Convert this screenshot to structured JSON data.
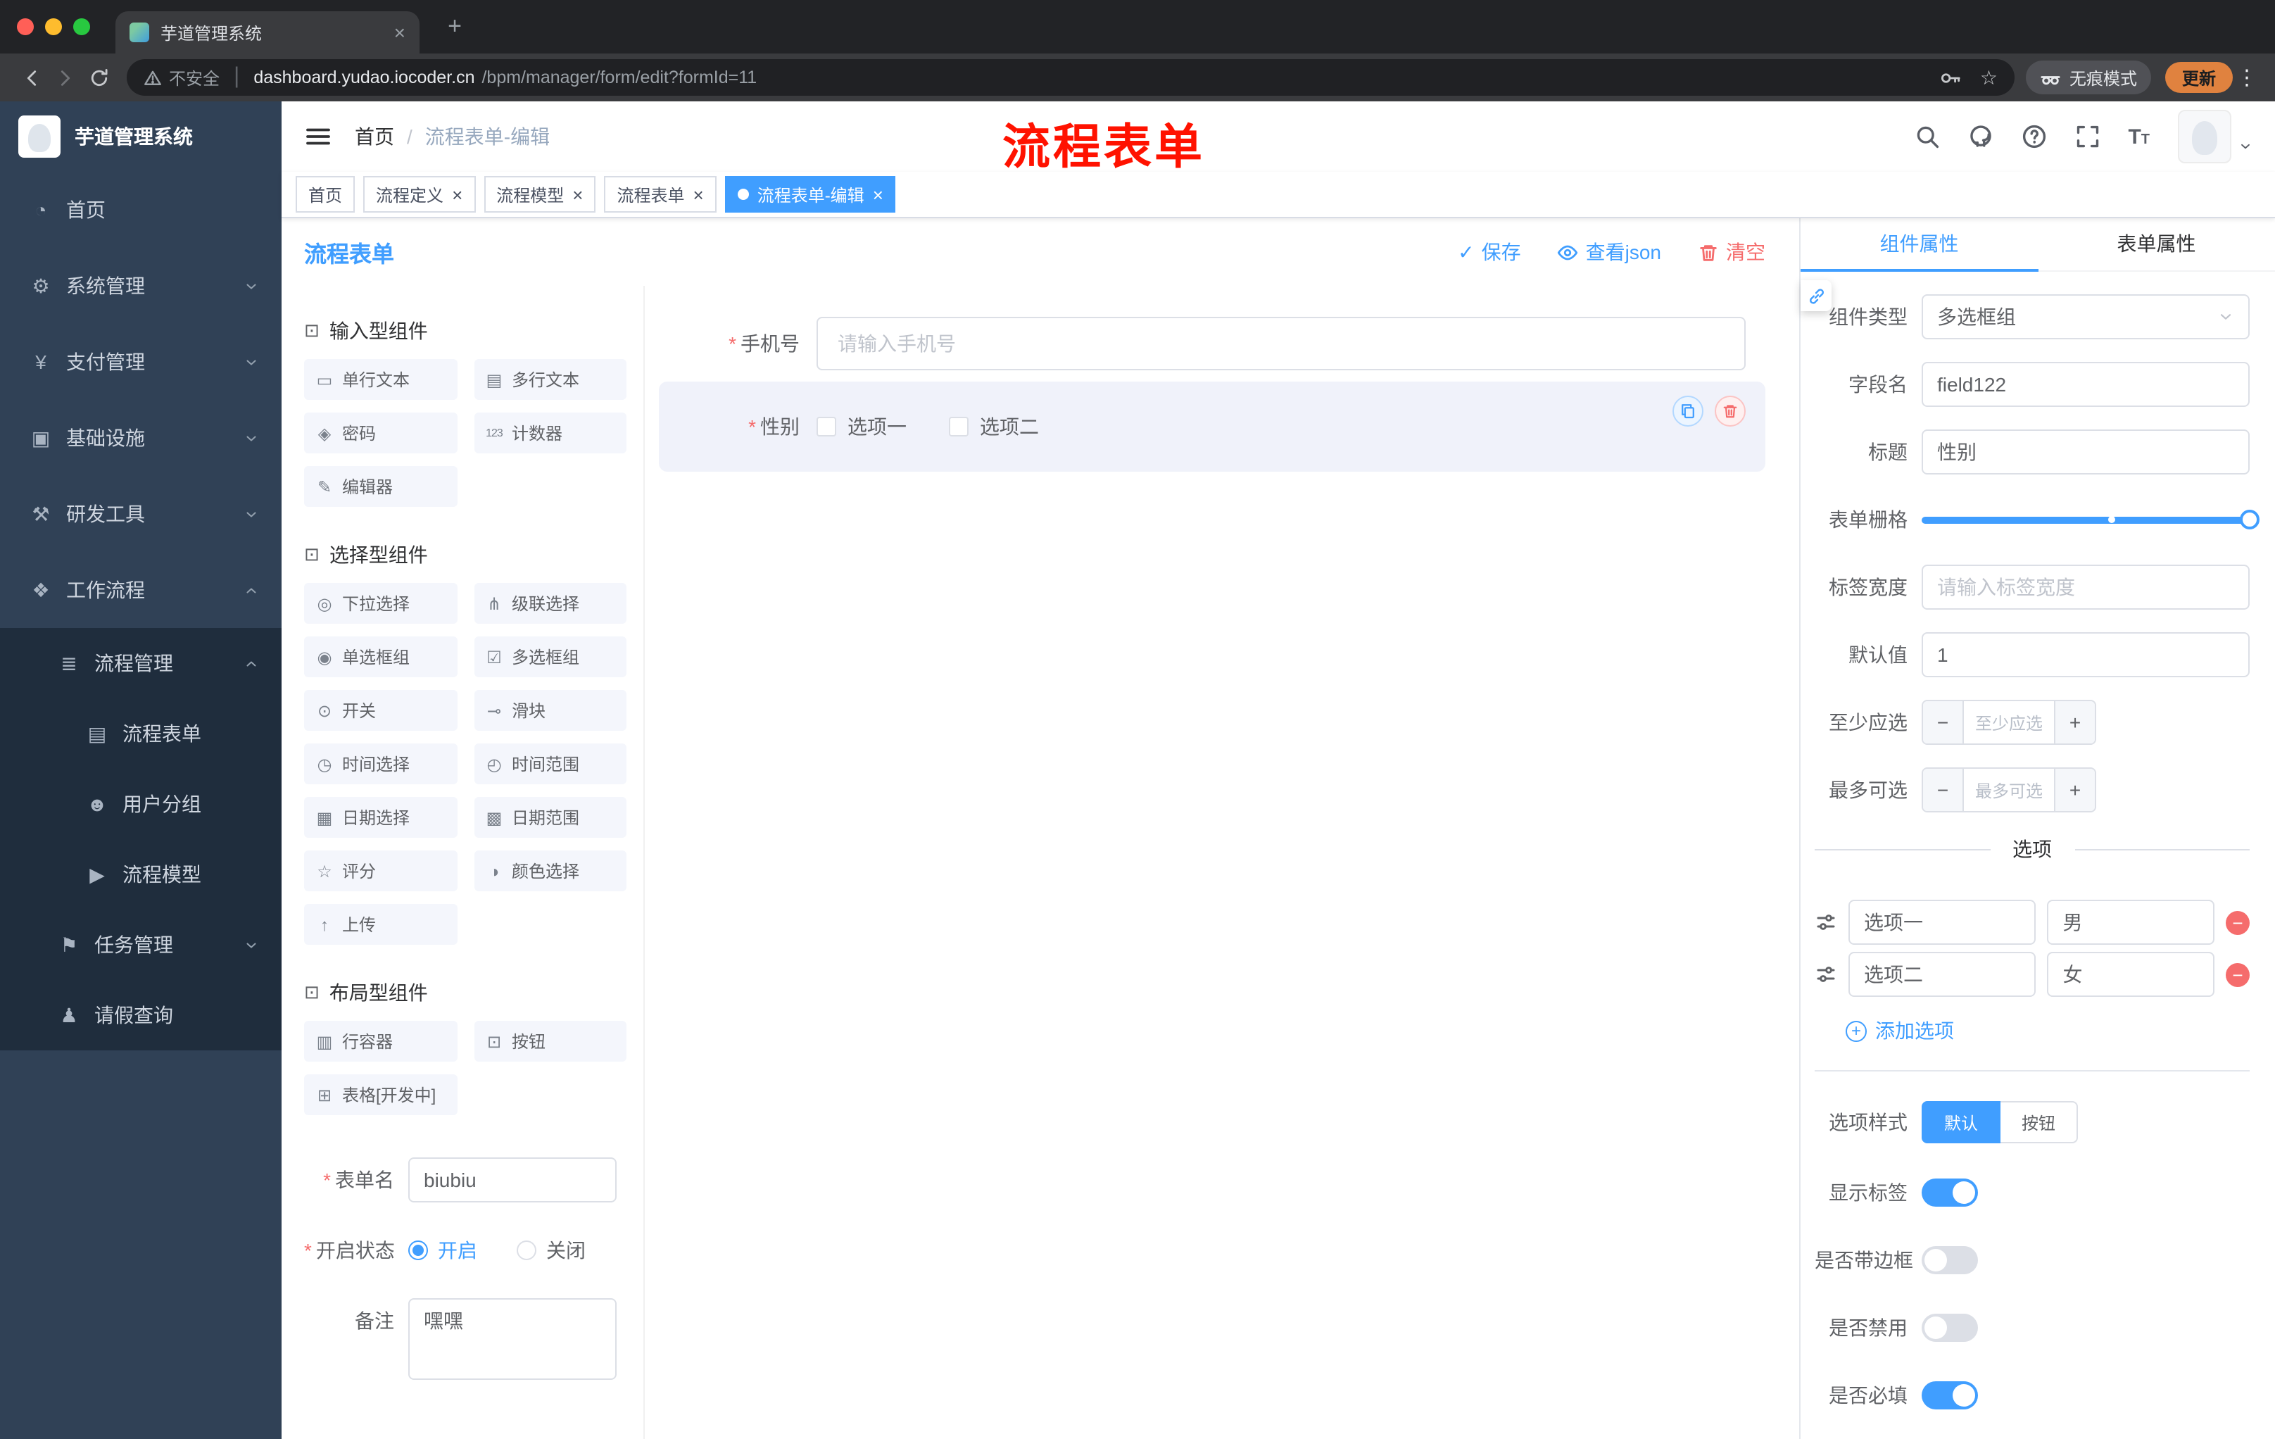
{
  "colors": {
    "accent": "#409eff",
    "danger": "#f56c6c",
    "sidebar_bg": "#304156",
    "submenu_bg": "#1f2d3d",
    "annotation_red": "#ff1200",
    "active_tag": "#409eff"
  },
  "browser": {
    "tab_title": "芋道管理系统",
    "security_label": "不安全",
    "url_domain": "dashboard.yudao.iocoder.cn",
    "url_path": "/bpm/manager/form/edit?formId=11",
    "incognito_label": "无痕模式",
    "update_label": "更新",
    "icons": [
      "back-icon",
      "forward-icon",
      "reload-icon",
      "warning-icon",
      "key-icon",
      "star-icon",
      "incognito-icon",
      "kebab-menu-icon"
    ]
  },
  "sidebar": {
    "logo_title": "芋道管理系统",
    "menu": [
      {
        "key": "home",
        "label": "首页",
        "icon": "gauge-icon",
        "level": 1
      },
      {
        "key": "system-mgmt",
        "label": "系统管理",
        "icon": "gear-icon",
        "level": 1,
        "chevron": "down"
      },
      {
        "key": "payment-mgmt",
        "label": "支付管理",
        "icon": "yen-icon",
        "level": 1,
        "chevron": "down"
      },
      {
        "key": "infrastructure",
        "label": "基础设施",
        "icon": "monitor-icon",
        "level": 1,
        "chevron": "down"
      },
      {
        "key": "dev-tools",
        "label": "研发工具",
        "icon": "tools-icon",
        "level": 1,
        "chevron": "down"
      },
      {
        "key": "workflow",
        "label": "工作流程",
        "icon": "briefcase-icon",
        "level": 1,
        "chevron": "up"
      },
      {
        "key": "process-mgmt",
        "label": "流程管理",
        "icon": "list-icon",
        "level": 2,
        "chevron": "up"
      },
      {
        "key": "process-form",
        "label": "流程表单",
        "icon": "document-icon",
        "level": 3
      },
      {
        "key": "user-group",
        "label": "用户分组",
        "icon": "chat-icon",
        "level": 3
      },
      {
        "key": "process-model",
        "label": "流程模型",
        "icon": "send-icon",
        "level": 3
      },
      {
        "key": "task-mgmt",
        "label": "任务管理",
        "icon": "flag-icon",
        "level": 2,
        "chevron": "down"
      },
      {
        "key": "leave-query",
        "label": "请假查询",
        "icon": "user-icon",
        "level": 2
      }
    ]
  },
  "header": {
    "breadcrumb": [
      "首页",
      "流程表单-编辑"
    ],
    "breadcrumb_separator": "/",
    "annotation": "流程表单",
    "icons": [
      "search-icon",
      "github-icon",
      "help-icon",
      "fullscreen-icon",
      "font-size-icon",
      "avatar",
      "chevron-down-icon"
    ]
  },
  "tags": [
    {
      "key": "home",
      "label": "首页",
      "closable": false,
      "active": false
    },
    {
      "key": "process-definition",
      "label": "流程定义",
      "closable": true,
      "active": false
    },
    {
      "key": "process-model",
      "label": "流程模型",
      "closable": true,
      "active": false
    },
    {
      "key": "process-form",
      "label": "流程表单",
      "closable": true,
      "active": false
    },
    {
      "key": "process-form-edit",
      "label": "流程表单-编辑",
      "closable": true,
      "active": true
    }
  ],
  "palette": {
    "panel_title": "流程表单",
    "groups": [
      {
        "title": "输入型组件",
        "icon": "cube-icon",
        "items": [
          {
            "label": "单行文本",
            "icon": "text-field-icon"
          },
          {
            "label": "多行文本",
            "icon": "textarea-icon"
          },
          {
            "label": "密码",
            "icon": "lock-icon"
          },
          {
            "label": "计数器",
            "icon": "counter-icon"
          },
          {
            "label": "编辑器",
            "icon": "editor-icon"
          }
        ]
      },
      {
        "title": "选择型组件",
        "icon": "cube-icon",
        "items": [
          {
            "label": "下拉选择",
            "icon": "select-icon"
          },
          {
            "label": "级联选择",
            "icon": "cascader-icon"
          },
          {
            "label": "单选框组",
            "icon": "radio-icon"
          },
          {
            "label": "多选框组",
            "icon": "checkbox-icon"
          },
          {
            "label": "开关",
            "icon": "switch-icon"
          },
          {
            "label": "滑块",
            "icon": "slider-icon"
          },
          {
            "label": "时间选择",
            "icon": "time-icon"
          },
          {
            "label": "时间范围",
            "icon": "time-range-icon"
          },
          {
            "label": "日期选择",
            "icon": "date-icon"
          },
          {
            "label": "日期范围",
            "icon": "date-range-icon"
          },
          {
            "label": "评分",
            "icon": "rate-icon"
          },
          {
            "label": "颜色选择",
            "icon": "color-icon"
          },
          {
            "label": "上传",
            "icon": "upload-icon"
          }
        ]
      },
      {
        "title": "布局型组件",
        "icon": "cube-icon",
        "items": [
          {
            "label": "行容器",
            "icon": "row-container-icon"
          },
          {
            "label": "按钮",
            "icon": "button-icon"
          },
          {
            "label": "表格[开发中]",
            "icon": "table-icon"
          }
        ]
      }
    ],
    "form": {
      "name_label": "表单名",
      "name_value": "biubiu",
      "status_label": "开启状态",
      "status_options": [
        {
          "label": "开启",
          "selected": true
        },
        {
          "label": "关闭",
          "selected": false
        }
      ],
      "remark_label": "备注",
      "remark_value": "嘿嘿"
    }
  },
  "canvas": {
    "toolbar": [
      {
        "key": "save",
        "label": "保存",
        "icon": "check-icon",
        "tone": "primary"
      },
      {
        "key": "view-json",
        "label": "查看json",
        "icon": "eye-icon",
        "tone": "primary"
      },
      {
        "key": "clear",
        "label": "清空",
        "icon": "trash-icon",
        "tone": "danger"
      }
    ],
    "phone_field": {
      "label": "手机号",
      "required": true,
      "placeholder": "请输入手机号"
    },
    "gender_field": {
      "label": "性别",
      "required": true,
      "options": [
        "选项一",
        "选项二"
      ],
      "selected": true,
      "actions": [
        "copy-icon",
        "delete-icon"
      ]
    }
  },
  "properties": {
    "tabs": [
      {
        "key": "component-props",
        "label": "组件属性",
        "active": true
      },
      {
        "key": "form-props",
        "label": "表单属性",
        "active": false
      }
    ],
    "rows": [
      {
        "key": "component-type",
        "label": "组件类型",
        "type": "select",
        "value": "多选框组"
      },
      {
        "key": "field-name",
        "label": "字段名",
        "type": "input",
        "value": "field122"
      },
      {
        "key": "title",
        "label": "标题",
        "type": "input",
        "value": "性别"
      },
      {
        "key": "form-grid",
        "label": "表单栅格",
        "type": "slider",
        "value": 24,
        "max": 24,
        "stop_percent": 58
      },
      {
        "key": "label-width",
        "label": "标签宽度",
        "type": "input",
        "placeholder": "请输入标签宽度"
      },
      {
        "key": "default-value",
        "label": "默认值",
        "type": "input",
        "value": "1"
      },
      {
        "key": "min-select",
        "label": "至少应选",
        "type": "stepper",
        "placeholder": "至少应选"
      },
      {
        "key": "max-select",
        "label": "最多可选",
        "type": "stepper",
        "placeholder": "最多可选"
      }
    ],
    "options_title": "选项",
    "options": [
      {
        "name": "选项一",
        "value": "男"
      },
      {
        "name": "选项二",
        "value": "女"
      }
    ],
    "add_option_label": "添加选项",
    "style_label": "选项样式",
    "style_options": [
      {
        "label": "默认",
        "active": true
      },
      {
        "label": "按钮",
        "active": false
      }
    ],
    "switches": [
      {
        "key": "show-label",
        "label": "显示标签",
        "on": true
      },
      {
        "key": "bordered",
        "label": "是否带边框",
        "on": false
      },
      {
        "key": "disabled",
        "label": "是否禁用",
        "on": false
      },
      {
        "key": "required",
        "label": "是否必填",
        "on": true
      }
    ]
  }
}
